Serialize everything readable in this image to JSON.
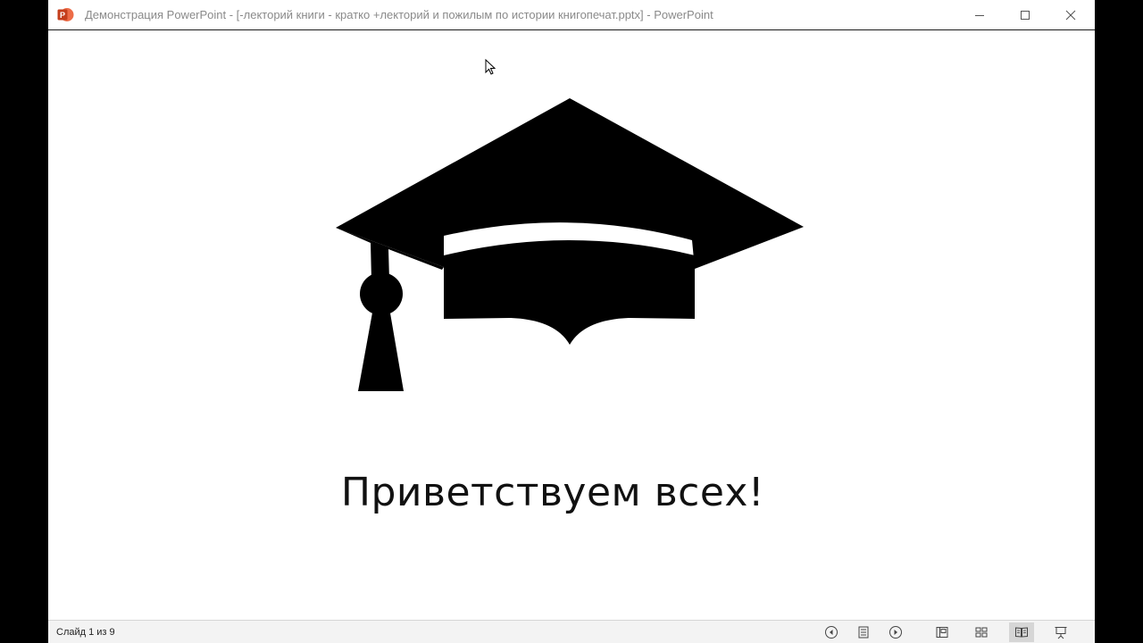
{
  "window": {
    "title": "Демонстрация PowerPoint - [-лекторий книги - кратко +лекторий и пожилым по истории книгопечат.pptx] - PowerPoint",
    "app_icon": "powerpoint-icon",
    "controls": [
      "minimize-icon",
      "maximize-icon",
      "close-icon"
    ]
  },
  "slide": {
    "graphic": "graduation-cap-icon",
    "title": "Приветствуем всех!"
  },
  "statusbar": {
    "slide_counter": "Слайд 1 из 9",
    "buttons": [
      "previous-icon",
      "menu-icon",
      "next-icon",
      "normal-view-icon",
      "slide-sorter-icon",
      "reading-view-icon",
      "slideshow-icon"
    ],
    "active_view": "reading-view"
  },
  "colors": {
    "accent": "#c43e1c",
    "background": "#000000",
    "slide": "#ffffff"
  }
}
